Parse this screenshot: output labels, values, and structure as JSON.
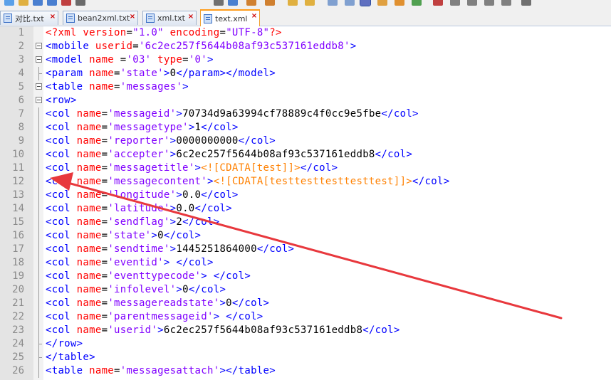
{
  "tabs": [
    {
      "label": "对比.txt"
    },
    {
      "label": "bean2xml.txt"
    },
    {
      "label": "xml.txt"
    },
    {
      "label": "text.xml"
    }
  ],
  "editor": {
    "lines": [
      {
        "n": "1",
        "fold": "none",
        "segs": [
          [
            "p",
            "<?xml "
          ],
          [
            "a",
            "version"
          ],
          [
            "x",
            "="
          ],
          [
            "v",
            "\"1.0\""
          ],
          [
            "x",
            " "
          ],
          [
            "a",
            "encoding"
          ],
          [
            "x",
            "="
          ],
          [
            "v",
            "\"UTF-8\""
          ],
          [
            "p",
            "?>"
          ]
        ]
      },
      {
        "n": "2",
        "fold": "marker",
        "segs": [
          [
            "t",
            "<mobile "
          ],
          [
            "a",
            "userid"
          ],
          [
            "x",
            "="
          ],
          [
            "v",
            "'6c2ec257f5644b08af93c537161eddb8'"
          ],
          [
            "t",
            ">"
          ]
        ]
      },
      {
        "n": "3",
        "fold": "marker",
        "segs": [
          [
            "t",
            "<model "
          ],
          [
            "a",
            "name "
          ],
          [
            "x",
            "="
          ],
          [
            "v",
            "'03'"
          ],
          [
            "x",
            " "
          ],
          [
            "a",
            "type"
          ],
          [
            "x",
            "="
          ],
          [
            "v",
            "'0'"
          ],
          [
            "t",
            ">"
          ]
        ]
      },
      {
        "n": "4",
        "fold": "end",
        "segs": [
          [
            "t",
            "<param "
          ],
          [
            "a",
            "name"
          ],
          [
            "x",
            "="
          ],
          [
            "v",
            "'state'"
          ],
          [
            "t",
            ">"
          ],
          [
            "x",
            "0"
          ],
          [
            "t",
            "</param></model>"
          ]
        ]
      },
      {
        "n": "5",
        "fold": "marker",
        "segs": [
          [
            "t",
            "<table "
          ],
          [
            "a",
            "name"
          ],
          [
            "x",
            "="
          ],
          [
            "v",
            "'messages'"
          ],
          [
            "t",
            ">"
          ]
        ]
      },
      {
        "n": "6",
        "fold": "marker",
        "segs": [
          [
            "t",
            "<row>"
          ]
        ]
      },
      {
        "n": "7",
        "fold": "line",
        "segs": [
          [
            "t",
            "<col "
          ],
          [
            "a",
            "name"
          ],
          [
            "x",
            "="
          ],
          [
            "v",
            "'messageid'"
          ],
          [
            "t",
            ">"
          ],
          [
            "x",
            "70734d9a63994cf78889c4f0cc9e5fbe"
          ],
          [
            "t",
            "</col>"
          ]
        ]
      },
      {
        "n": "8",
        "fold": "line",
        "segs": [
          [
            "t",
            "<col "
          ],
          [
            "a",
            "name"
          ],
          [
            "x",
            "="
          ],
          [
            "v",
            "'messagetype'"
          ],
          [
            "t",
            ">"
          ],
          [
            "x",
            "1"
          ],
          [
            "t",
            "</col>"
          ]
        ]
      },
      {
        "n": "9",
        "fold": "line",
        "segs": [
          [
            "t",
            "<col "
          ],
          [
            "a",
            "name"
          ],
          [
            "x",
            "="
          ],
          [
            "v",
            "'reporter'"
          ],
          [
            "t",
            ">"
          ],
          [
            "x",
            "0000000000"
          ],
          [
            "t",
            "</col>"
          ]
        ]
      },
      {
        "n": "10",
        "fold": "line",
        "segs": [
          [
            "t",
            "<col "
          ],
          [
            "a",
            "name"
          ],
          [
            "x",
            "="
          ],
          [
            "v",
            "'accepter'"
          ],
          [
            "t",
            ">"
          ],
          [
            "x",
            "6c2ec257f5644b08af93c537161eddb8"
          ],
          [
            "t",
            "</col>"
          ]
        ]
      },
      {
        "n": "11",
        "fold": "line",
        "segs": [
          [
            "t",
            "<col "
          ],
          [
            "a",
            "name"
          ],
          [
            "x",
            "="
          ],
          [
            "v",
            "'messagetitle'"
          ],
          [
            "t",
            ">"
          ],
          [
            "c",
            "<![CDATA[test]]>"
          ],
          [
            "t",
            "</col>"
          ]
        ]
      },
      {
        "n": "12",
        "fold": "line",
        "segs": [
          [
            "t",
            "<col "
          ],
          [
            "a",
            "name"
          ],
          [
            "x",
            "="
          ],
          [
            "v",
            "'messagecontent'"
          ],
          [
            "t",
            ">"
          ],
          [
            "c",
            "<![CDATA[testtesttesttesttest]]>"
          ],
          [
            "t",
            "</col>"
          ]
        ]
      },
      {
        "n": "13",
        "fold": "line",
        "segs": [
          [
            "t",
            "<col "
          ],
          [
            "a",
            "name"
          ],
          [
            "x",
            "="
          ],
          [
            "v",
            "'longitude'"
          ],
          [
            "t",
            ">"
          ],
          [
            "x",
            "0.0"
          ],
          [
            "t",
            "</col>"
          ]
        ]
      },
      {
        "n": "14",
        "fold": "line",
        "segs": [
          [
            "t",
            "<col "
          ],
          [
            "a",
            "name"
          ],
          [
            "x",
            "="
          ],
          [
            "v",
            "'latitude'"
          ],
          [
            "t",
            ">"
          ],
          [
            "x",
            "0.0"
          ],
          [
            "t",
            "</col>"
          ]
        ]
      },
      {
        "n": "15",
        "fold": "line",
        "segs": [
          [
            "t",
            "<col "
          ],
          [
            "a",
            "name"
          ],
          [
            "x",
            "="
          ],
          [
            "v",
            "'sendflag'"
          ],
          [
            "t",
            ">"
          ],
          [
            "x",
            "2"
          ],
          [
            "t",
            "</col>"
          ]
        ]
      },
      {
        "n": "16",
        "fold": "line",
        "segs": [
          [
            "t",
            "<col "
          ],
          [
            "a",
            "name"
          ],
          [
            "x",
            "="
          ],
          [
            "v",
            "'state'"
          ],
          [
            "t",
            ">"
          ],
          [
            "x",
            "0"
          ],
          [
            "t",
            "</col>"
          ]
        ]
      },
      {
        "n": "17",
        "fold": "line",
        "segs": [
          [
            "t",
            "<col "
          ],
          [
            "a",
            "name"
          ],
          [
            "x",
            "="
          ],
          [
            "v",
            "'sendtime'"
          ],
          [
            "t",
            ">"
          ],
          [
            "x",
            "1445251864000"
          ],
          [
            "t",
            "</col>"
          ]
        ]
      },
      {
        "n": "18",
        "fold": "line",
        "segs": [
          [
            "t",
            "<col "
          ],
          [
            "a",
            "name"
          ],
          [
            "x",
            "="
          ],
          [
            "v",
            "'eventid'"
          ],
          [
            "t",
            "> </col>"
          ]
        ]
      },
      {
        "n": "19",
        "fold": "line",
        "segs": [
          [
            "t",
            "<col "
          ],
          [
            "a",
            "name"
          ],
          [
            "x",
            "="
          ],
          [
            "v",
            "'eventtypecode'"
          ],
          [
            "t",
            "> </col>"
          ]
        ]
      },
      {
        "n": "20",
        "fold": "line",
        "segs": [
          [
            "t",
            "<col "
          ],
          [
            "a",
            "name"
          ],
          [
            "x",
            "="
          ],
          [
            "v",
            "'infolevel'"
          ],
          [
            "t",
            ">"
          ],
          [
            "x",
            "0"
          ],
          [
            "t",
            "</col>"
          ]
        ]
      },
      {
        "n": "21",
        "fold": "line",
        "segs": [
          [
            "t",
            "<col "
          ],
          [
            "a",
            "name"
          ],
          [
            "x",
            "="
          ],
          [
            "v",
            "'messagereadstate'"
          ],
          [
            "t",
            ">"
          ],
          [
            "x",
            "0"
          ],
          [
            "t",
            "</col>"
          ]
        ]
      },
      {
        "n": "22",
        "fold": "line",
        "segs": [
          [
            "t",
            "<col "
          ],
          [
            "a",
            "name"
          ],
          [
            "x",
            "="
          ],
          [
            "v",
            "'parentmessageid'"
          ],
          [
            "t",
            "> </col>"
          ]
        ]
      },
      {
        "n": "23",
        "fold": "line",
        "segs": [
          [
            "t",
            "<col "
          ],
          [
            "a",
            "name"
          ],
          [
            "x",
            "="
          ],
          [
            "v",
            "'userid'"
          ],
          [
            "t",
            ">"
          ],
          [
            "x",
            "6c2ec257f5644b08af93c537161eddb8"
          ],
          [
            "t",
            "</col>"
          ]
        ]
      },
      {
        "n": "24",
        "fold": "end",
        "segs": [
          [
            "t",
            "</row>"
          ]
        ]
      },
      {
        "n": "25",
        "fold": "end",
        "segs": [
          [
            "t",
            "</table>"
          ]
        ]
      },
      {
        "n": "26",
        "fold": "line",
        "segs": [
          [
            "t",
            "<table "
          ],
          [
            "a",
            "name"
          ],
          [
            "x",
            "="
          ],
          [
            "v",
            "'messagesattach'"
          ],
          [
            "t",
            "></table>"
          ]
        ]
      }
    ]
  },
  "colors": {
    "tag": "#0000ff",
    "attribute": "#ff0000",
    "value": "#8000ff",
    "cdata": "#ff8000",
    "annotation_arrow": "#e8383d"
  }
}
